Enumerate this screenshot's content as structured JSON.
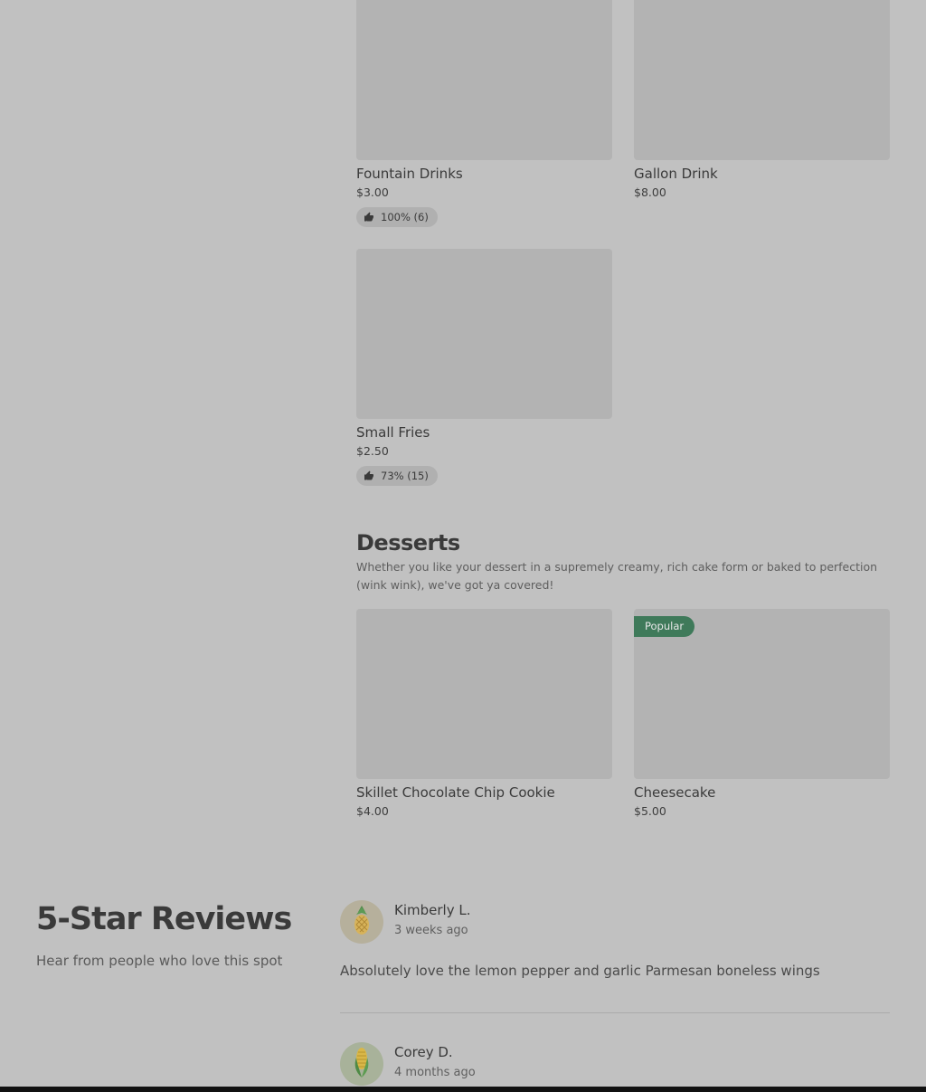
{
  "drinks": {
    "items": [
      {
        "name": "Fountain Drinks",
        "price": "$3.00",
        "rating": "100% (6)"
      },
      {
        "name": "Gallon Drink",
        "price": "$8.00"
      },
      {
        "name": "Small Fries",
        "price": "$2.50",
        "rating": "73% (15)"
      }
    ]
  },
  "desserts": {
    "title": "Desserts",
    "description": "Whether you like your dessert in a supremely creamy, rich cake form or baked to perfection (wink wink), we've got ya covered!",
    "items": [
      {
        "name": "Skillet Chocolate Chip Cookie",
        "price": "$4.00"
      },
      {
        "name": "Cheesecake",
        "price": "$5.00",
        "badge": "Popular"
      }
    ]
  },
  "reviews": {
    "title": "5-Star Reviews",
    "subtitle": "Hear from people who love this spot",
    "items": [
      {
        "name": "Kimberly L.",
        "date": "3 weeks ago",
        "text": "Absolutely love the lemon pepper and garlic Parmesan boneless wings",
        "avatar_icon": "pineapple-icon"
      },
      {
        "name": "Corey D.",
        "date": "4 months ago",
        "avatar_icon": "corn-icon"
      }
    ]
  },
  "colors": {
    "background": "#c1c1c1",
    "placeholder": "#b3b3b3",
    "popular_badge": "#3f7a5a"
  }
}
